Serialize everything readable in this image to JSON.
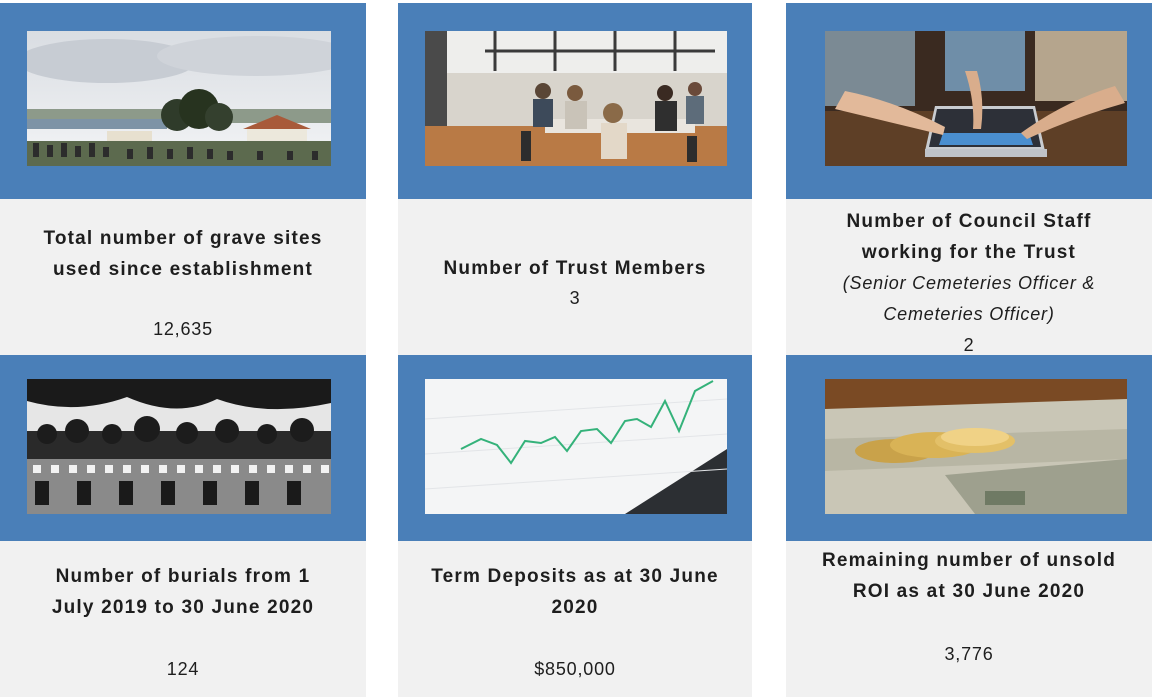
{
  "cards": [
    {
      "image": "cemetery-landscape-photo",
      "title_line1": "Total number of grave sites",
      "title_line2": "used since establishment",
      "value": "12,635"
    },
    {
      "image": "meeting-room-photo",
      "title_line1": "Number of Trust Members",
      "value": "3"
    },
    {
      "image": "laptop-hands-photo",
      "title_line1": "Number of Council Staff",
      "title_line2": "working for the Trust",
      "note_line1": "(Senior Cemeteries Officer &",
      "note_line2": "Cemeteries Officer)",
      "value": "2"
    },
    {
      "image": "war-graves-bw-photo",
      "title_line1": "Number of burials from 1",
      "title_line2": "July 2019 to 30 June 2020",
      "value": "124"
    },
    {
      "image": "stock-chart-photo",
      "title_line1": "Term Deposits as at 30 June",
      "title_line2": "2020",
      "value": "$850,000"
    },
    {
      "image": "gold-coins-banknotes-photo",
      "title_line1": "Remaining number of unsold",
      "title_line2": "ROI as at 30 June 2020",
      "value": "3,776"
    }
  ],
  "colors": {
    "frame": "#4a7fb8",
    "panel": "#f1f1f1",
    "text": "#1e1e1e"
  }
}
